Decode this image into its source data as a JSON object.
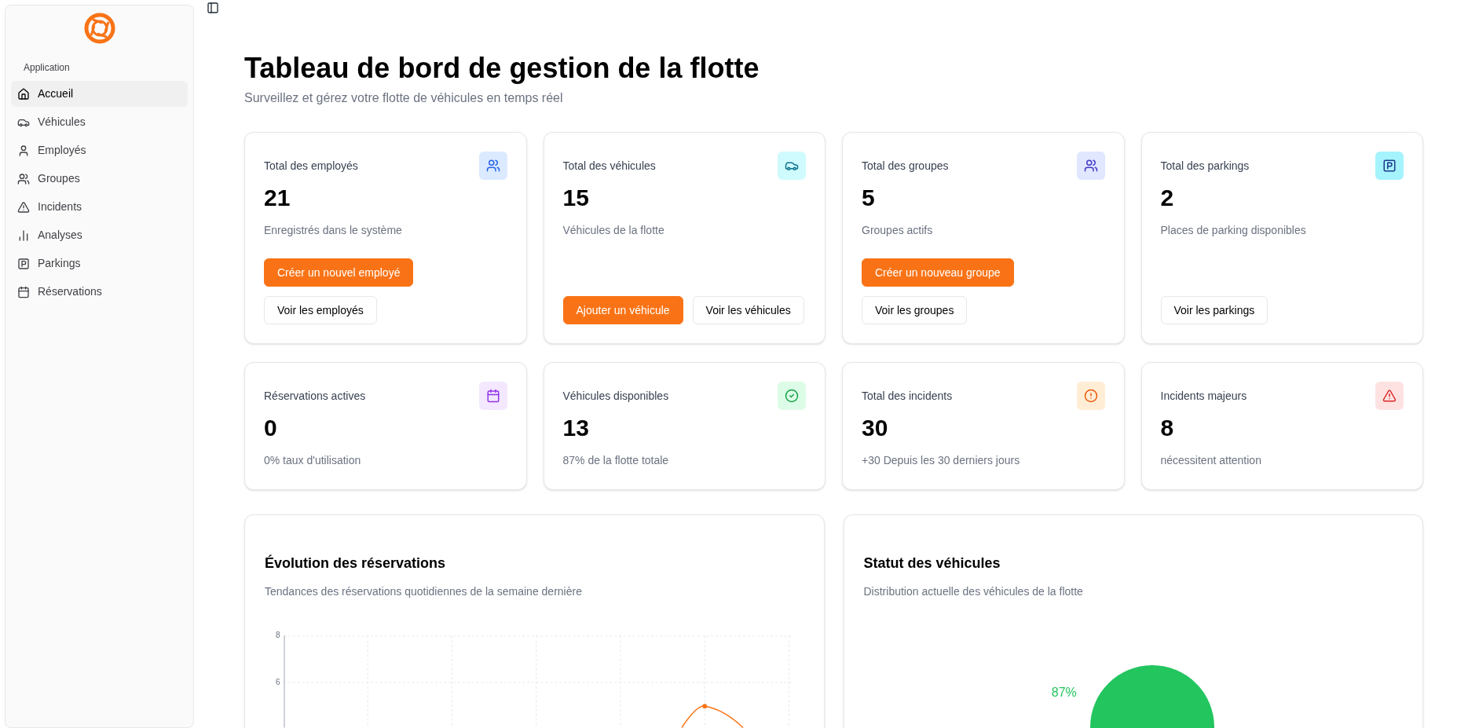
{
  "sidebar": {
    "group_label": "Application",
    "items": [
      {
        "label": "Accueil",
        "selected": true
      },
      {
        "label": "Véhicules",
        "selected": false
      },
      {
        "label": "Employés",
        "selected": false
      },
      {
        "label": "Groupes",
        "selected": false
      },
      {
        "label": "Incidents",
        "selected": false
      },
      {
        "label": "Analyses",
        "selected": false
      },
      {
        "label": "Parkings",
        "selected": false
      },
      {
        "label": "Réservations",
        "selected": false
      }
    ]
  },
  "header": {
    "title": "Tableau de bord de gestion de la flotte",
    "subtitle": "Surveillez et gérez votre flotte de véhicules en temps réel"
  },
  "stat_cards": [
    {
      "label": "Total des employés",
      "value": "21",
      "description": "Enregistrés dans le système",
      "buttons": [
        {
          "label": "Créer un nouvel employé",
          "kind": "primary"
        },
        {
          "label": "Voir les employés",
          "kind": "outline"
        }
      ]
    },
    {
      "label": "Total des véhicules",
      "value": "15",
      "description": "Véhicules de la flotte",
      "buttons": [
        {
          "label": "Ajouter un véhicule",
          "kind": "primary"
        },
        {
          "label": "Voir les véhicules",
          "kind": "outline"
        }
      ]
    },
    {
      "label": "Total des groupes",
      "value": "5",
      "description": "Groupes actifs",
      "buttons": [
        {
          "label": "Créer un nouveau groupe",
          "kind": "primary"
        },
        {
          "label": "Voir les groupes",
          "kind": "outline"
        }
      ]
    },
    {
      "label": "Total des parkings",
      "value": "2",
      "description": "Places de parking disponibles",
      "buttons": [
        {
          "label": "Voir les parkings",
          "kind": "outline"
        }
      ]
    },
    {
      "label": "Réservations actives",
      "value": "0",
      "description": "0% taux d'utilisation"
    },
    {
      "label": "Véhicules disponibles",
      "value": "13",
      "description": "87% de la flotte totale"
    },
    {
      "label": "Total des incidents",
      "value": "30",
      "description": "+30 Depuis les 30 derniers jours"
    },
    {
      "label": "Incidents majeurs",
      "value": "8",
      "description": "nécessitent attention"
    }
  ],
  "reservations_chart": {
    "title": "Évolution des réservations",
    "subtitle": "Tendances des réservations quotidiennes de la semaine dernière",
    "y_tick_labels": [
      "8",
      "6"
    ]
  },
  "vehicle_status_chart": {
    "title": "Statut des véhicules",
    "subtitle": "Distribution actuelle des véhicules de la flotte",
    "slice_label": "87%"
  }
}
